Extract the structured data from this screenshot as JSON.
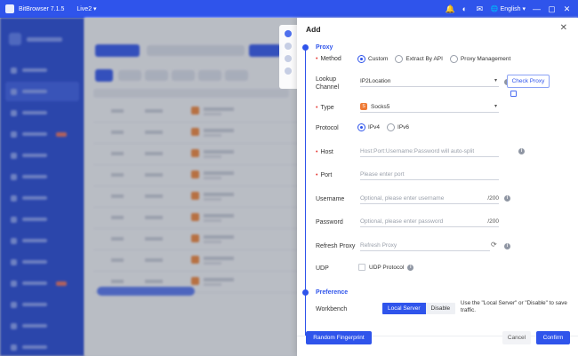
{
  "titlebar": {
    "app_name": "BitBrowser 7.1.5",
    "profile": "Live2",
    "language": "English"
  },
  "dialog": {
    "title": "Add",
    "sections": {
      "proxy": "Proxy",
      "preference": "Preference"
    },
    "method": {
      "label": "Method",
      "options": [
        "Custom",
        "Extract By API",
        "Proxy Management"
      ],
      "selected": "Custom"
    },
    "lookup": {
      "label": "Lookup Channel",
      "value": "IP2Location",
      "check_button": "Check Proxy"
    },
    "type": {
      "label": "Type",
      "value": "Socks5"
    },
    "protocol": {
      "label": "Protocol",
      "options": [
        "IPv4",
        "IPv6"
      ],
      "selected": "IPv4"
    },
    "host": {
      "label": "Host",
      "placeholder": "Host:Port:Username:Password will auto-split"
    },
    "port": {
      "label": "Port",
      "placeholder": "Please enter port"
    },
    "username": {
      "label": "Username",
      "placeholder": "Optional, please enter username",
      "counter": "/200"
    },
    "password": {
      "label": "Password",
      "placeholder": "Optional, please enter password",
      "counter": "/200"
    },
    "refresh_proxy": {
      "label": "Refresh Proxy",
      "placeholder": "Refresh Proxy"
    },
    "udp": {
      "label": "UDP",
      "checkbox_label": "UDP Protocol"
    },
    "workbench": {
      "label": "Workbench",
      "options": [
        "Local Server",
        "Disable"
      ],
      "selected": "Local Server",
      "note": "Use the \"Local Server\" or \"Disable\" to save traffic."
    },
    "footer": {
      "random_button": "Random Fingerprint",
      "cancel_button": "Cancel",
      "confirm_button": "Confirm"
    }
  },
  "colors": {
    "brand": "#2f54eb",
    "required": "#e53935",
    "socks_icon": "#ef7a35"
  }
}
